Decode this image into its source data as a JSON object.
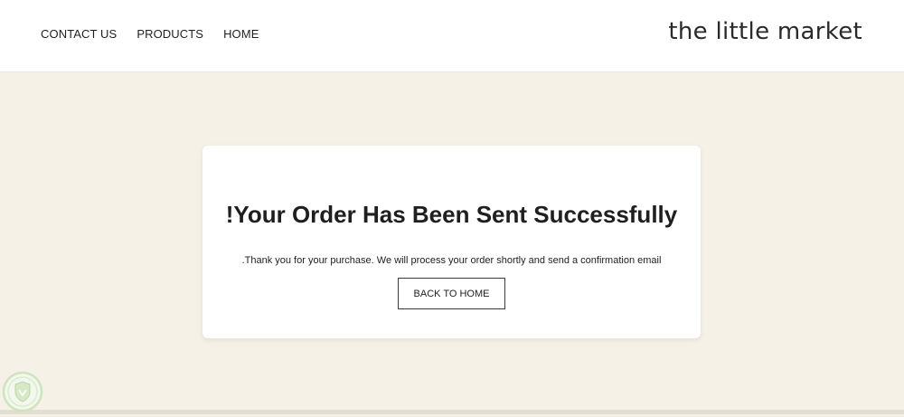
{
  "header": {
    "nav": [
      {
        "label": "CONTACT US"
      },
      {
        "label": "PRODUCTS"
      },
      {
        "label": "HOME"
      }
    ],
    "brand": "the little market"
  },
  "card": {
    "title": "!Your Order Has Been Sent Successfully",
    "message": ".Thank you for your purchase. We will process your order shortly and send a confirmation email",
    "button_label": "BACK TO HOME"
  },
  "colors": {
    "page_bg": "#f5f1e7",
    "header_bg": "#ffffff",
    "card_bg": "#ffffff",
    "text": "#1f1f1f",
    "badge": "#c9e0b3"
  },
  "icons": {
    "badge": "shield-icon"
  }
}
